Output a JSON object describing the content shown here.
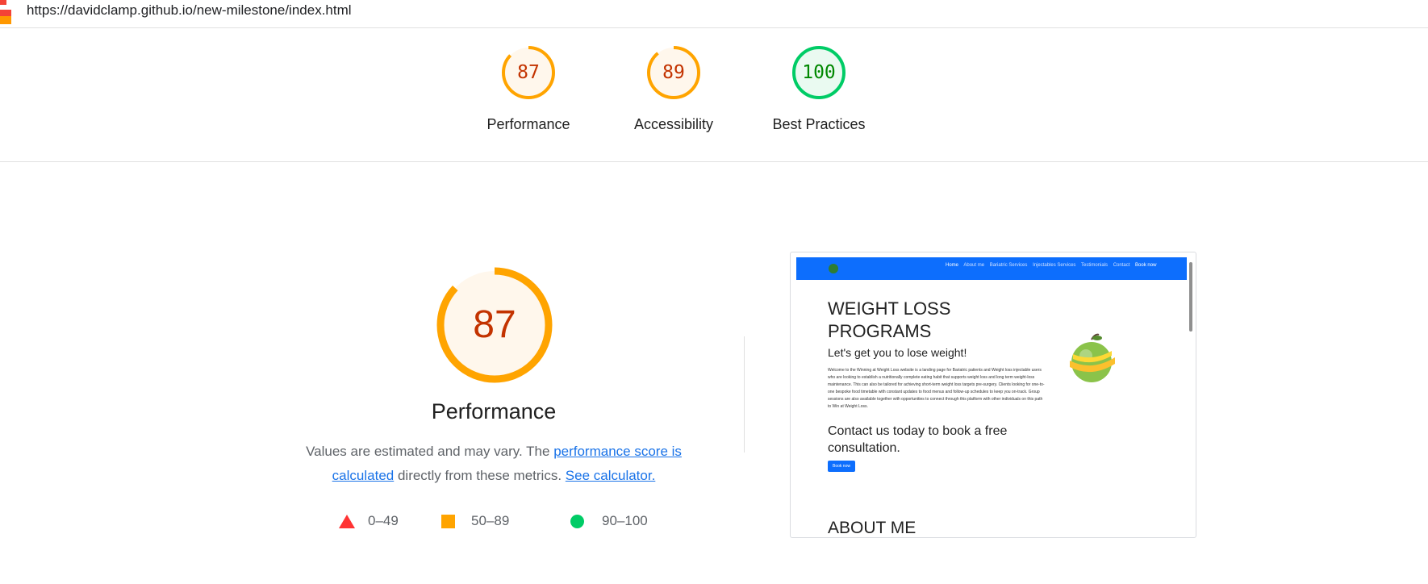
{
  "topbar": {
    "url": "https://davidclamp.github.io/new-milestone/index.html"
  },
  "scores": [
    {
      "label": "Performance",
      "value": "87",
      "fraction": 0.87,
      "status": "average"
    },
    {
      "label": "Accessibility",
      "value": "89",
      "fraction": 0.89,
      "status": "average"
    },
    {
      "label": "Best Practices",
      "value": "100",
      "fraction": 1.0,
      "status": "pass"
    }
  ],
  "performance": {
    "score": "87",
    "fraction": 0.87,
    "title": "Performance",
    "desc_prefix": "Values are estimated and may vary. The ",
    "link_score": "performance score is calculated",
    "desc_mid": " directly from these metrics. ",
    "link_calc": "See calculator."
  },
  "legend": [
    {
      "shape": "triangle",
      "range": "0–49",
      "color": "#ff3333"
    },
    {
      "shape": "square",
      "range": "50–89",
      "color": "#ffa400"
    },
    {
      "shape": "circle",
      "range": "90–100",
      "color": "#00cc66"
    }
  ],
  "colors": {
    "average_stroke": "#ffa400",
    "average_fill": "#fff7ec",
    "average_text": "#c33300",
    "pass_stroke": "#00cc66",
    "pass_fill": "#eafaf1",
    "pass_text": "#008800"
  },
  "screenshot": {
    "nav_links": [
      "Home",
      "About me",
      "Bariatric Services",
      "Injectables Services",
      "Testimonials",
      "Contact",
      "Book now"
    ],
    "heading": "WEIGHT LOSS PROGRAMS",
    "subheading": "Let's get you to lose weight!",
    "paragraph": "Welcome to the Winning at Weight Loss website is a landing page for Bariatric patients and Weight loss injectable users who are looking to establish a nutritionally complete eating habit that supports weight loss and long term weight-loss maintenance. This can also be tailored for achieving short-term weight loss targets pre-surgery. Clients looking for one-to-one bespoke food timetable with constant updates to food menus and follow-up schedules to keep you on-track. Group sessions are also available together with opportunities to connect through this platform with other individuals on this path to Win at Weight Loss.",
    "cta": "Contact us today to book a free consultation.",
    "button": "Book now",
    "about": "ABOUT ME"
  }
}
